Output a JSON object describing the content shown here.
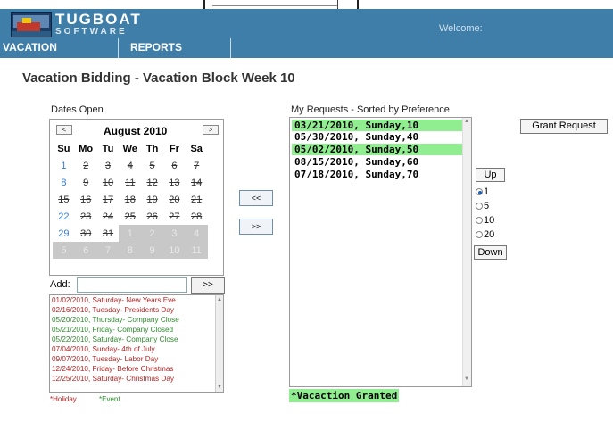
{
  "brand": {
    "name": "TUGBOAT",
    "sub": "SOFTWARE"
  },
  "welcome": "Welcome:",
  "nav": [
    "VACATION",
    "REPORTS"
  ],
  "title": "Vacation Bidding - Vacation Block Week 10",
  "dates_open_label": "Dates Open",
  "calendar": {
    "prev": "<",
    "next": ">",
    "month": "August 2010",
    "weekdays": [
      "Su",
      "Mo",
      "Tu",
      "We",
      "Th",
      "Fr",
      "Sa"
    ],
    "weeks": [
      [
        "1",
        "2",
        "3",
        "4",
        "5",
        "6",
        "7"
      ],
      [
        "8",
        "9",
        "10",
        "11",
        "12",
        "13",
        "14"
      ],
      [
        "15",
        "16",
        "17",
        "18",
        "19",
        "20",
        "21"
      ],
      [
        "22",
        "23",
        "24",
        "25",
        "26",
        "27",
        "28"
      ],
      [
        "29",
        "30",
        "31",
        "1",
        "2",
        "3",
        "4"
      ],
      [
        "5",
        "6",
        "7",
        "8",
        "9",
        "10",
        "11"
      ]
    ]
  },
  "add": {
    "label": "Add:",
    "button": ">>"
  },
  "holidays": [
    {
      "text": "01/02/2010, Saturday- New Years Eve",
      "type": "holiday"
    },
    {
      "text": "02/16/2010, Tuesday- Presidents Day",
      "type": "holiday"
    },
    {
      "text": "05/20/2010, Thursday- Company Close",
      "type": "event"
    },
    {
      "text": "05/21/2010, Friday- Company Closed",
      "type": "event"
    },
    {
      "text": "05/22/2010, Saturday- Company Close",
      "type": "event"
    },
    {
      "text": "07/04/2010, Sunday- 4th of July",
      "type": "holiday"
    },
    {
      "text": "09/07/2010, Tuesday- Labor Day",
      "type": "holiday"
    },
    {
      "text": "12/24/2010, Friday- Before Christmas",
      "type": "holiday"
    },
    {
      "text": "12/25/2010, Saturday- Christmas Day",
      "type": "holiday"
    }
  ],
  "legend": {
    "holiday": "*Holiday",
    "event": "*Event"
  },
  "move": {
    "left": "<<",
    "right": ">>"
  },
  "requests_label": "My Requests - Sorted by Preference",
  "requests": [
    {
      "text": "03/21/2010, Sunday,10",
      "granted": true
    },
    {
      "text": "05/30/2010, Sunday,40",
      "granted": false
    },
    {
      "text": "05/02/2010, Sunday,50",
      "granted": true
    },
    {
      "text": "08/15/2010, Sunday,60",
      "granted": false
    },
    {
      "text": "07/18/2010, Sunday,70",
      "granted": false
    }
  ],
  "granted_legend": "*Vacaction Granted",
  "controls": {
    "grant": "Grant Request",
    "up": "Up",
    "down": "Down",
    "steps": [
      "1",
      "5",
      "10",
      "20"
    ],
    "selected_step": "1"
  }
}
